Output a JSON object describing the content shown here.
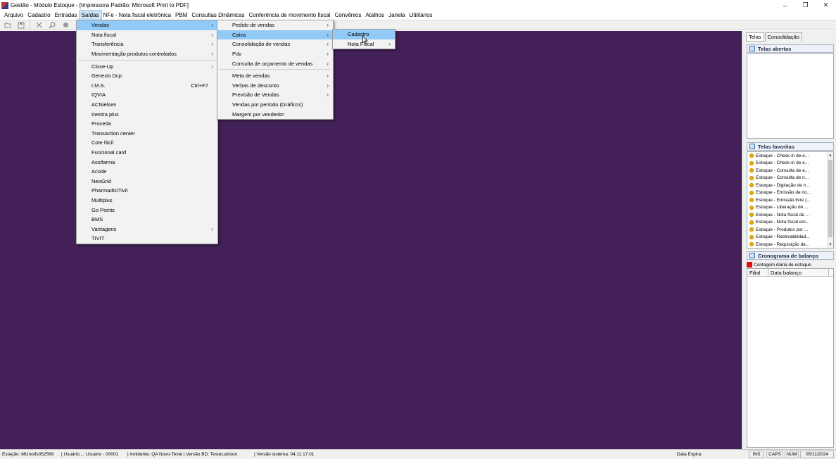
{
  "window": {
    "title": "Gestão - Módulo Estoque - [Impressora Padrão: Microsoft Print to PDF]",
    "minimize": "–",
    "maximize": "❐",
    "close": "✕"
  },
  "menubar": [
    {
      "label": "Arquivo"
    },
    {
      "label": "Cadastro"
    },
    {
      "label": "Entradas"
    },
    {
      "label": "Saídas"
    },
    {
      "label": "NFe - Nota fiscal eletrônica"
    },
    {
      "label": "PBM"
    },
    {
      "label": "Consultas Dinâmicas"
    },
    {
      "label": "Conferência de movimento fiscal"
    },
    {
      "label": "Convênios"
    },
    {
      "label": "Atalhos"
    },
    {
      "label": "Janela"
    },
    {
      "label": "Utilitários"
    }
  ],
  "saidas_menu": [
    {
      "label": "Vendas"
    },
    {
      "label": "Nota fiscal"
    },
    {
      "label": "Transferência"
    },
    {
      "label": "Movimentação produtos controlados"
    },
    {
      "label": "Close-Up"
    },
    {
      "label": "Genexis Dcp"
    },
    {
      "label": "I.M.S.",
      "shortcut": "Ctrl+F7"
    },
    {
      "label": "IQVIA"
    },
    {
      "label": "ACNielsen"
    },
    {
      "label": "Inestra plus"
    },
    {
      "label": "Proceda"
    },
    {
      "label": "Transaction center"
    },
    {
      "label": "Cote fácil"
    },
    {
      "label": "Funcional card"
    },
    {
      "label": "Assifarma"
    },
    {
      "label": "Acode"
    },
    {
      "label": "NeoGrid"
    },
    {
      "label": "Pharmadis\\Tivit"
    },
    {
      "label": "Multiplus"
    },
    {
      "label": "Go Points"
    },
    {
      "label": "BMS"
    },
    {
      "label": "Vantagens"
    },
    {
      "label": "TIVIT"
    }
  ],
  "vendas_menu": [
    {
      "label": "Pedido de vendas"
    },
    {
      "label": "Caixa"
    },
    {
      "label": "Consolidação de vendas"
    },
    {
      "label": "Pdv"
    },
    {
      "label": "Consulta de orçamento de vendas"
    },
    {
      "label": "Meta de vendas"
    },
    {
      "label": "Verbas de desconto"
    },
    {
      "label": "Previsão de Vendas"
    },
    {
      "label": "Vendas por período (Gráficos)"
    },
    {
      "label": "Margem por vendedor"
    }
  ],
  "caixa_menu": [
    {
      "label": "Cadastro"
    },
    {
      "label": "Nota Fiscal"
    }
  ],
  "right_panel": {
    "tabs": [
      "Telas",
      "Consolidação"
    ],
    "open_screens_title": "Telas abertas",
    "favorites_title": "Telas favoritas",
    "favorites": [
      "Estoque - Check-in de e...",
      "Estoque - Check-in de e...",
      "Estoque - Consulta de e...",
      "Estoque - Consulta de n...",
      "Estoque - Digitação de n...",
      "Estoque - Emissão de no...",
      "Estoque - Emissão livre (...",
      "Estoque - Liberação de ...",
      "Estoque - Nota fiscal de ...",
      "Estoque - Nota fiscal em...",
      "Estoque - Produtos por ...",
      "Estoque - Rastreabilidad...",
      "Estoque - Requisição de..."
    ],
    "schedule_title": "Cronograma de balanço",
    "schedule_legend": "Contagem diária de estoque",
    "grid_columns": [
      "Filial",
      "Data balanço"
    ]
  },
  "statusbar": {
    "estacao": "Estação: Mtznotfs052569",
    "usuario": "| Usuário...: Usuario - 00001",
    "ambiente": "| Ambiente: QA Novo-Teste | Versão BD: TesteLuidson",
    "versao": "| Versão sistema: 04.11.17.01",
    "data_expira": "Data Expira:",
    "ins": "INS",
    "caps": "CAPS",
    "num": "NUM",
    "date": "05/11/2024"
  },
  "colors": {
    "workspace": "#432158",
    "menu_highlight": "#91c9f7"
  }
}
